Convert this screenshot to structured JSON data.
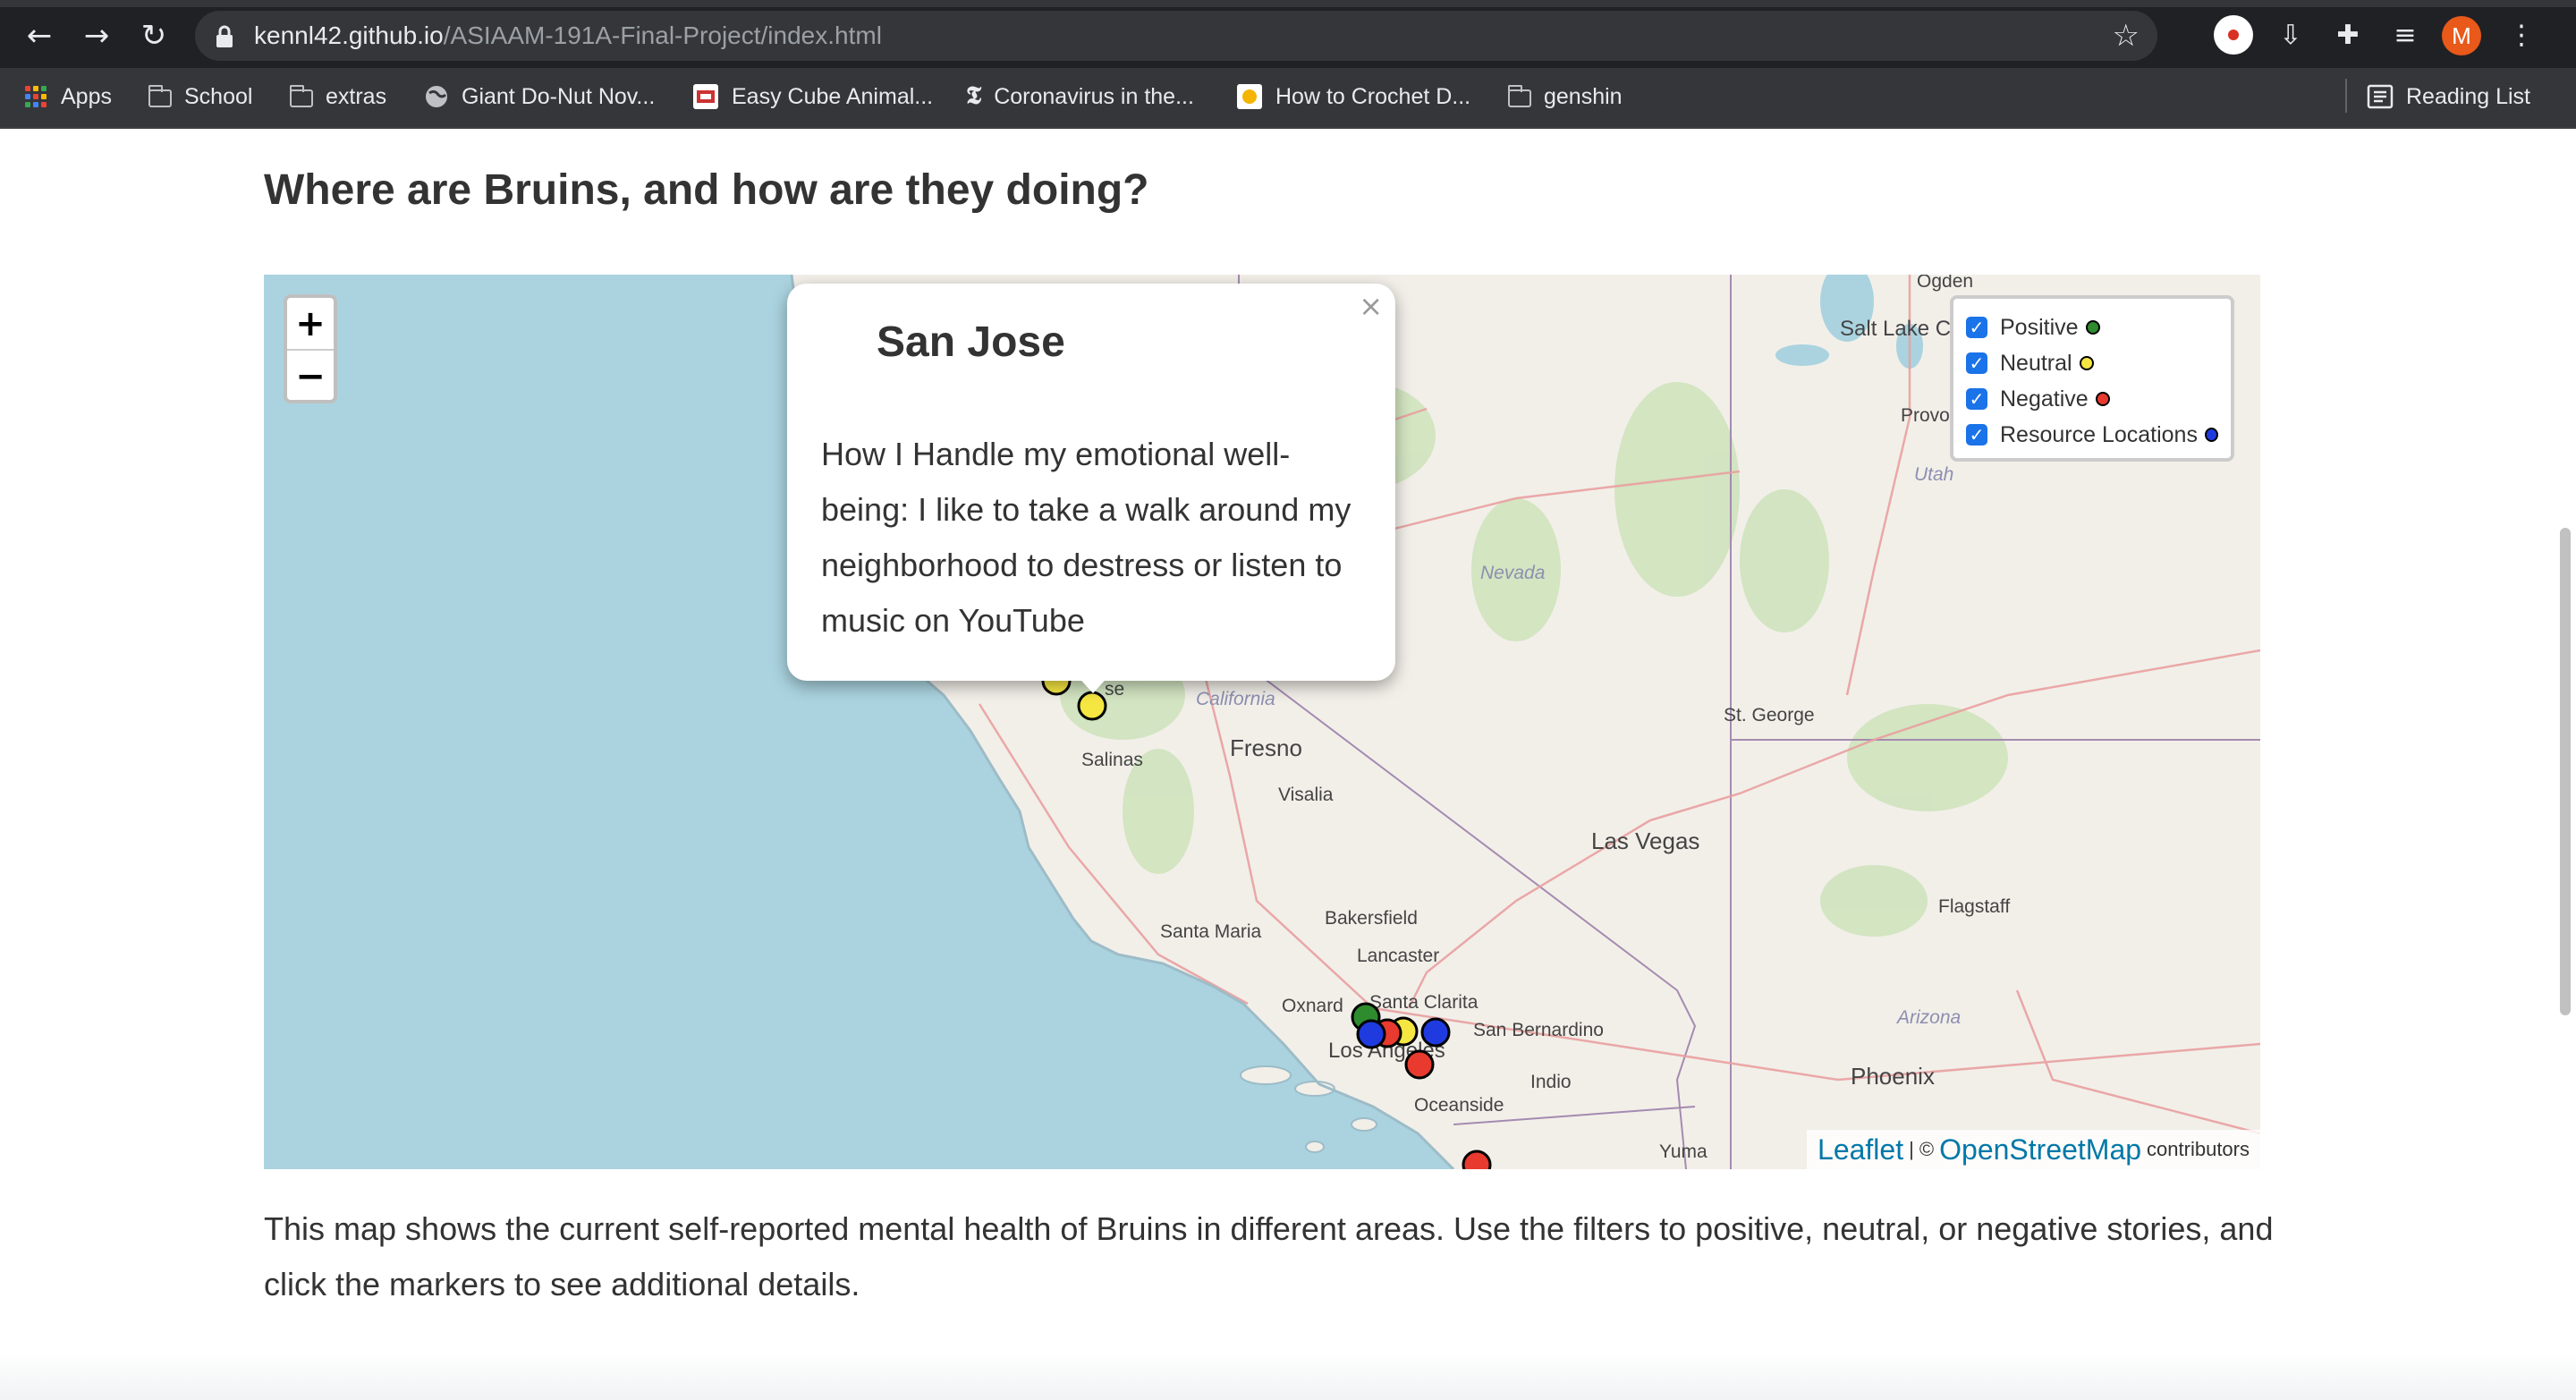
{
  "browser": {
    "url_host": "kennl42.github.io",
    "url_path": "/ASIAAM-191A-Final-Project/index.html",
    "avatar_letter": "M",
    "bookmarks": [
      {
        "label": "Apps",
        "icon": "apps-icon"
      },
      {
        "label": "School",
        "icon": "folder-icon"
      },
      {
        "label": "extras",
        "icon": "folder-icon"
      },
      {
        "label": "Giant Do-Nut Nov...",
        "icon": "globe-icon"
      },
      {
        "label": "Easy Cube Animal...",
        "icon": "site-icon"
      },
      {
        "label": "Coronavirus in the...",
        "icon": "nyt-icon"
      },
      {
        "label": "How to Crochet D...",
        "icon": "site-icon"
      },
      {
        "label": "genshin",
        "icon": "folder-icon"
      }
    ],
    "reading_list": "Reading List"
  },
  "page": {
    "heading": "Where are Bruins, and how are they doing?",
    "caption": "This map shows the current self-reported mental health of Bruins in different areas. Use the filters to positive, neutral, or negative stories, and click the markers to see additional details."
  },
  "map": {
    "zoom_in": "+",
    "zoom_out": "−",
    "popup": {
      "title": "San Jose",
      "body": "How I Handle my emotional well-being: I like to take a walk around my neighborhood to destress or listen to music on YouTube",
      "close": "×"
    },
    "legend": [
      {
        "label": "Positive",
        "color": "#2e8b2e",
        "checked": true
      },
      {
        "label": "Neutral",
        "color": "#f5e642",
        "checked": true
      },
      {
        "label": "Negative",
        "color": "#e83a2e",
        "checked": true
      },
      {
        "label": "Resource Locations",
        "color": "#1f3be0",
        "checked": true
      }
    ],
    "attribution": {
      "leaflet": "Leaflet",
      "separator": "| ©",
      "osm": "OpenStreetMap",
      "suffix": "contributors"
    },
    "place_labels": [
      "Ogden",
      "Salt Lake Ci",
      "Provo",
      "Utah",
      "Nevada",
      "California",
      "Fresno",
      "Salinas",
      "Visalia",
      "St. George",
      "Las Vegas",
      "Bakersfield",
      "Santa Maria",
      "Lancaster",
      "Flagstaff",
      "Oxnard",
      "Santa Clarita",
      "San Bernardino",
      "Los Angeles",
      "Arizona",
      "Indio",
      "Phoenix",
      "Oceanside",
      "Yuma",
      "se"
    ]
  }
}
